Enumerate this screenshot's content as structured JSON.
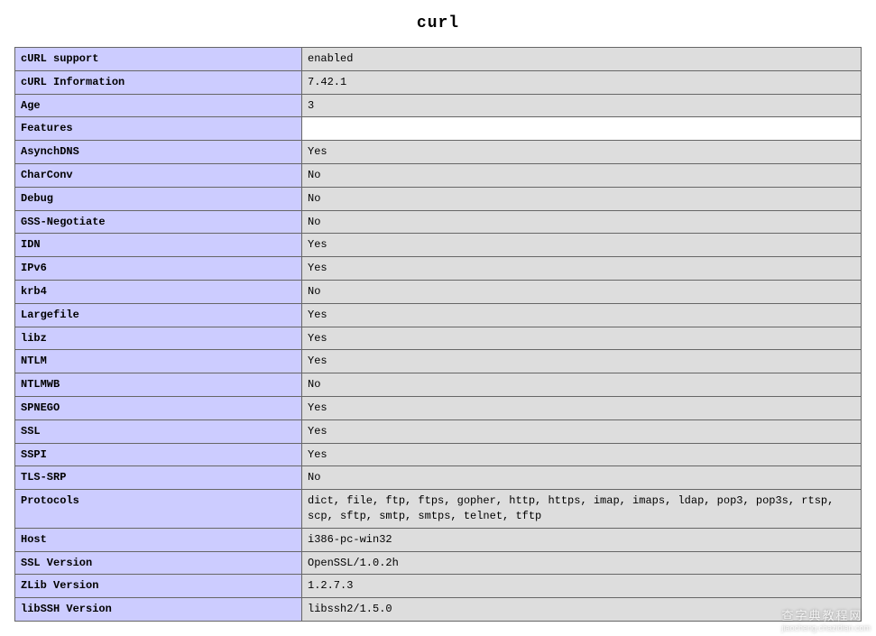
{
  "title": "curl",
  "rows": [
    {
      "key": "cURL support",
      "value": "enabled"
    },
    {
      "key": "cURL Information",
      "value": "7.42.1"
    },
    {
      "key": "Age",
      "value": "3"
    },
    {
      "key": "Features",
      "value": ""
    },
    {
      "key": "AsynchDNS",
      "value": "Yes"
    },
    {
      "key": "CharConv",
      "value": "No"
    },
    {
      "key": "Debug",
      "value": "No"
    },
    {
      "key": "GSS-Negotiate",
      "value": "No"
    },
    {
      "key": "IDN",
      "value": "Yes"
    },
    {
      "key": "IPv6",
      "value": "Yes"
    },
    {
      "key": "krb4",
      "value": "No"
    },
    {
      "key": "Largefile",
      "value": "Yes"
    },
    {
      "key": "libz",
      "value": "Yes"
    },
    {
      "key": "NTLM",
      "value": "Yes"
    },
    {
      "key": "NTLMWB",
      "value": "No"
    },
    {
      "key": "SPNEGO",
      "value": "Yes"
    },
    {
      "key": "SSL",
      "value": "Yes"
    },
    {
      "key": "SSPI",
      "value": "Yes"
    },
    {
      "key": "TLS-SRP",
      "value": "No"
    },
    {
      "key": "Protocols",
      "value": "dict, file, ftp, ftps, gopher, http, https, imap, imaps, ldap, pop3, pop3s, rtsp, scp, sftp, smtp, smtps, telnet, tftp"
    },
    {
      "key": "Host",
      "value": "i386-pc-win32"
    },
    {
      "key": "SSL Version",
      "value": "OpenSSL/1.0.2h"
    },
    {
      "key": "ZLib Version",
      "value": "1.2.7.3"
    },
    {
      "key": "libSSH Version",
      "value": "libssh2/1.5.0"
    }
  ],
  "watermark": {
    "main": "查字典教程网",
    "sub": "jiaocheng.chazidian.com"
  }
}
